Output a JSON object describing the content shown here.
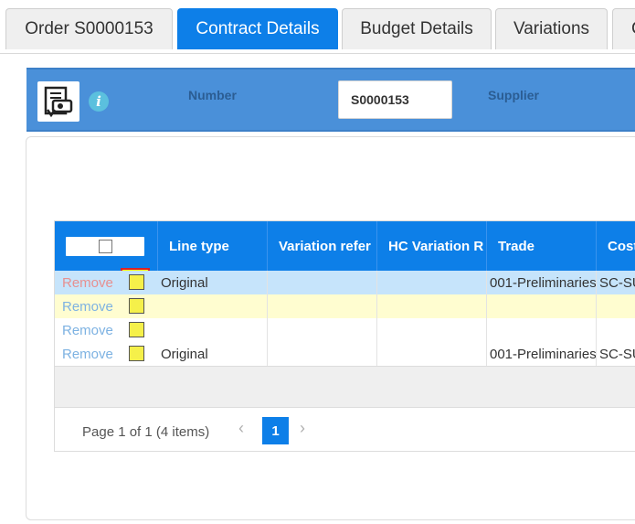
{
  "tabs": [
    {
      "label": "Order S0000153"
    },
    {
      "label": "Contract Details"
    },
    {
      "label": "Budget Details"
    },
    {
      "label": "Variations"
    },
    {
      "label": "C"
    }
  ],
  "active_tab": "Contract Details",
  "header": {
    "number_label": "Number",
    "number_value": "S0000153",
    "supplier_label": "Supplier",
    "info_glyph": "i"
  },
  "grid": {
    "columns": [
      "Line type",
      "Variation refer",
      "HC Variation R",
      "Trade",
      "Cost"
    ],
    "rows": [
      {
        "action": "Remove",
        "line_type": "Original",
        "variation_ref": "",
        "hc_variation": "",
        "trade": "001-Preliminaries",
        "cost": "SC-SU"
      },
      {
        "action": "Remove",
        "line_type": "",
        "variation_ref": "",
        "hc_variation": "",
        "trade": "",
        "cost": ""
      },
      {
        "action": "Remove",
        "line_type": "",
        "variation_ref": "",
        "hc_variation": "",
        "trade": "",
        "cost": ""
      },
      {
        "action": "Remove",
        "line_type": "Original",
        "variation_ref": "",
        "hc_variation": "",
        "trade": "001-Preliminaries",
        "cost": "SC-SU"
      }
    ]
  },
  "pager": {
    "info": "Page 1 of 1 (4 items)",
    "current_page": "1",
    "prev_glyph": "‹",
    "next_glyph": "›"
  },
  "colors": {
    "accent": "#0d7fe8",
    "header_band": "#4a90d9",
    "selected_row": "#c6e4fb",
    "highlight_row": "#fffdd0",
    "checkbox_highlight": "#ffff00",
    "highlight_frame": "#d8202a"
  }
}
